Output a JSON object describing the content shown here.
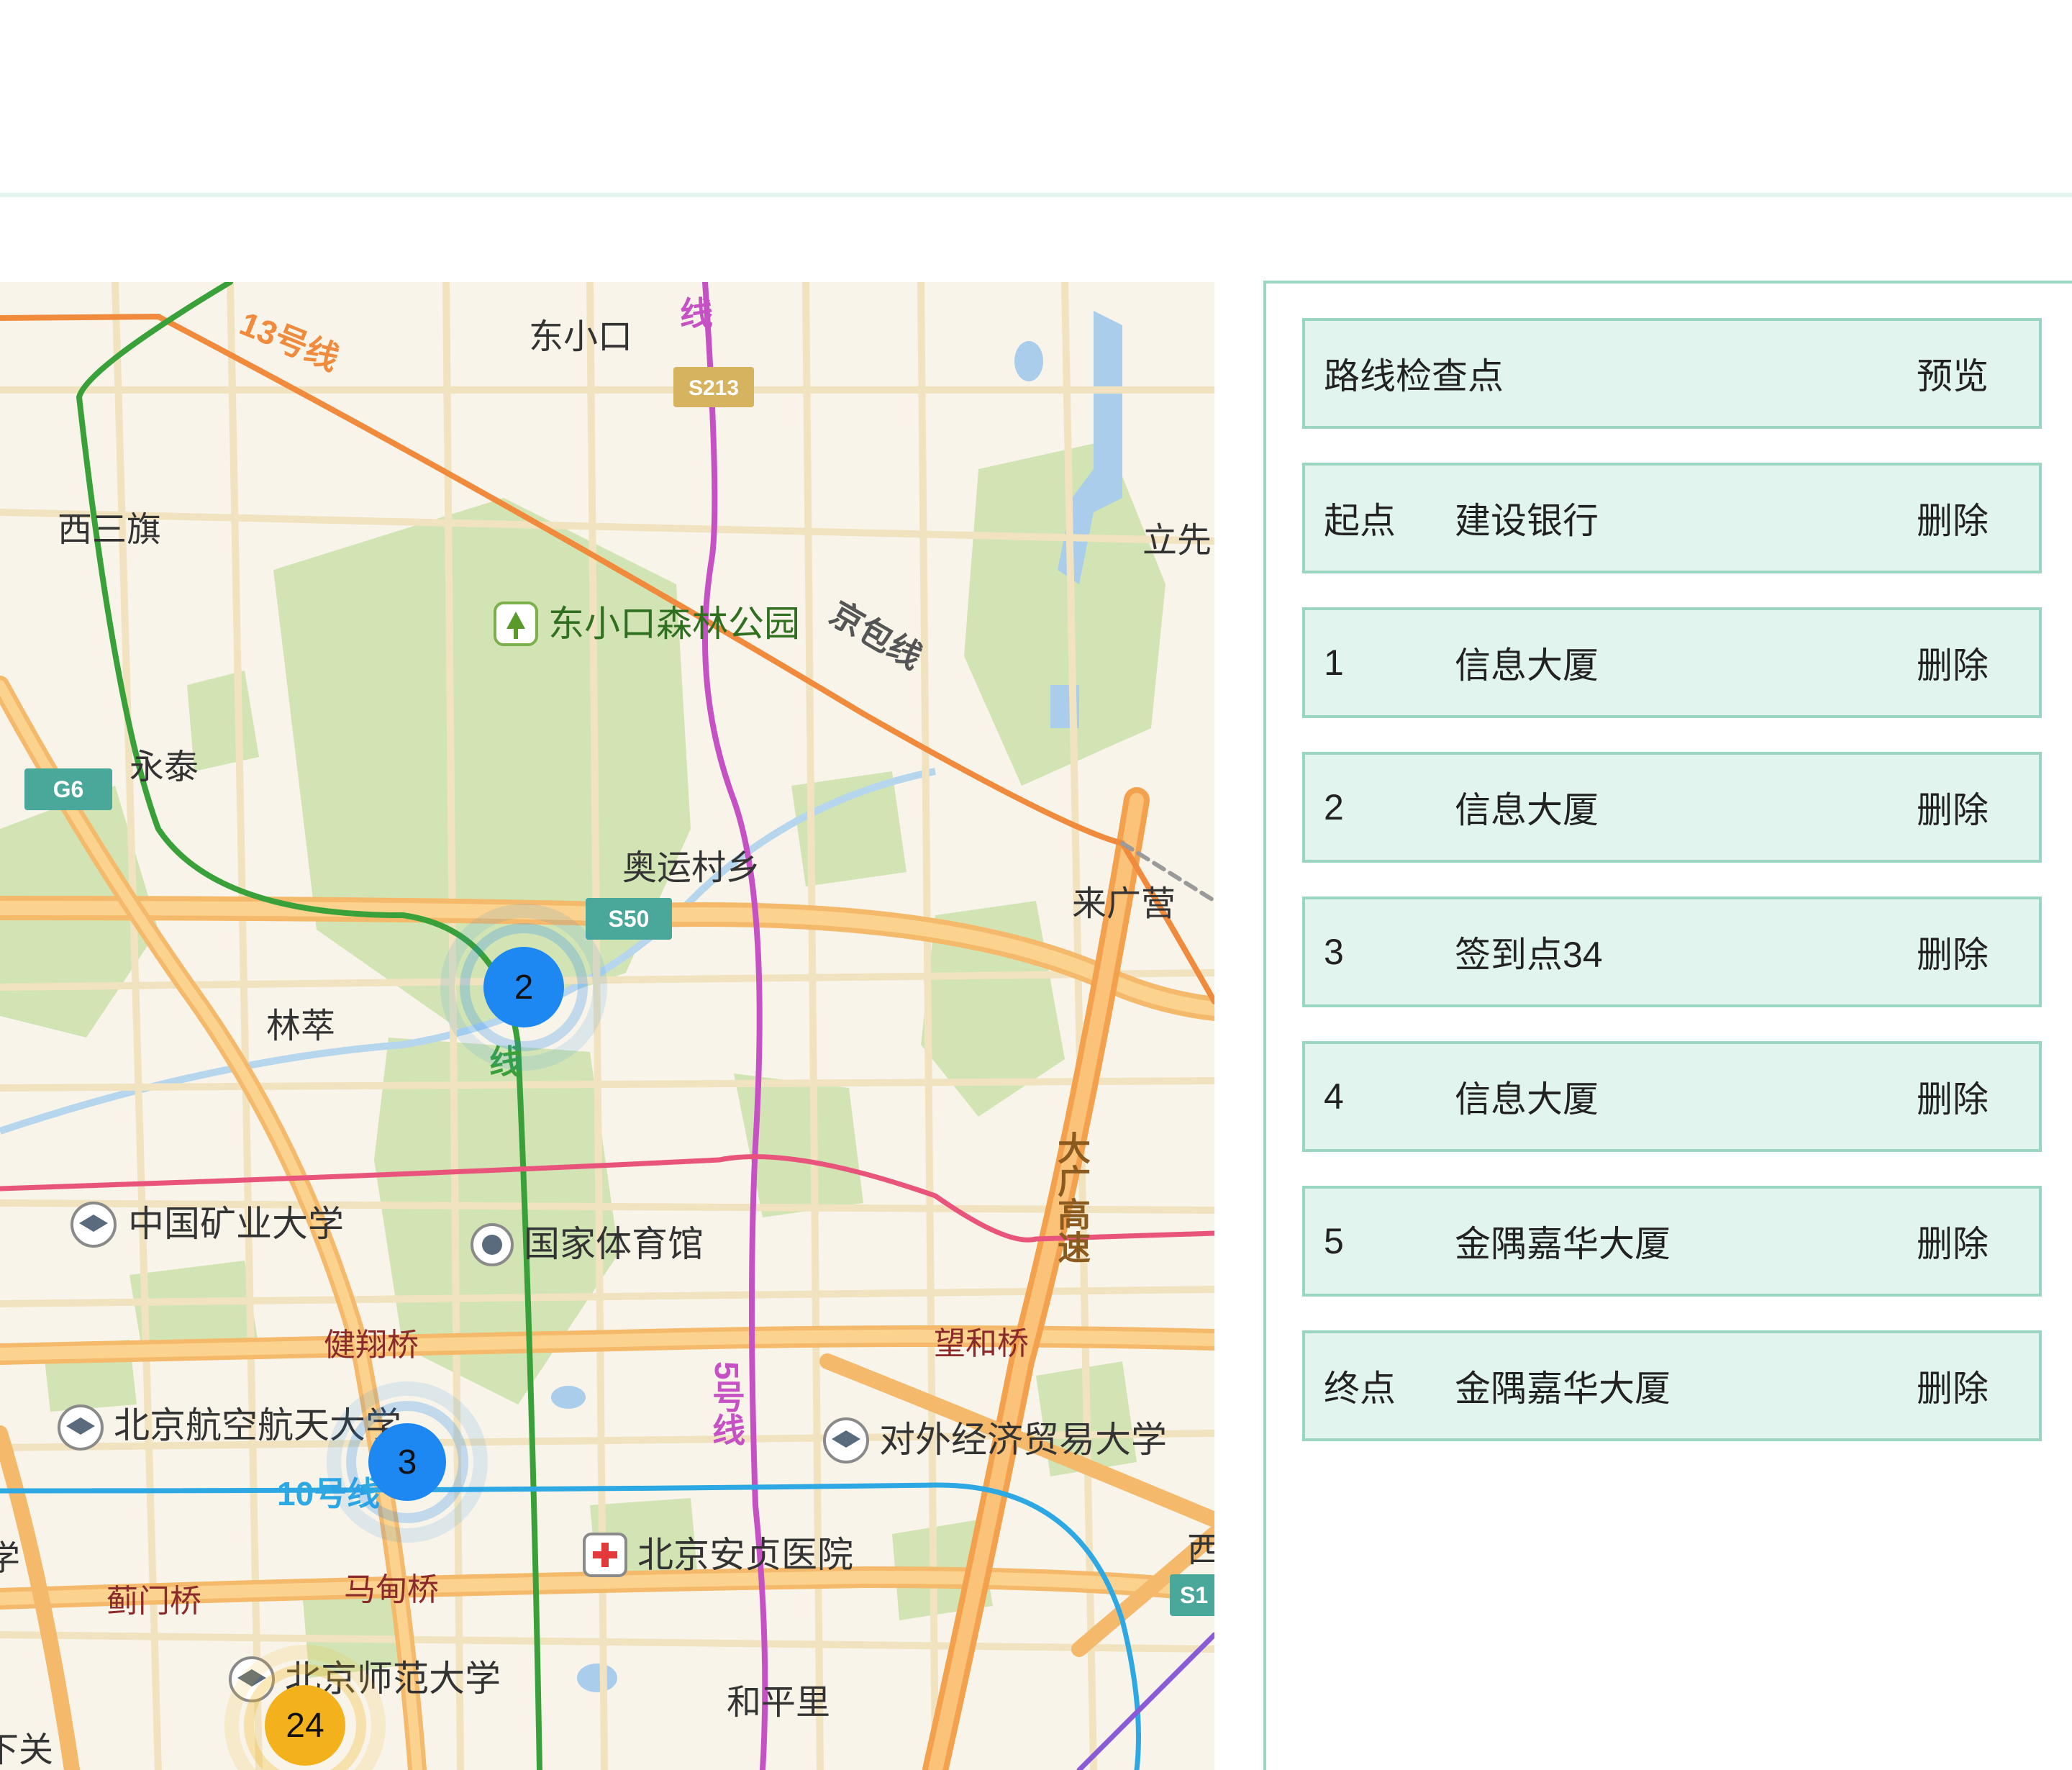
{
  "panel": {
    "header": {
      "title": "路线检查点",
      "action": "预览"
    },
    "rows": [
      {
        "label": "起点",
        "place": "建设银行",
        "action": "删除"
      },
      {
        "label": "1",
        "place": "信息大厦",
        "action": "删除"
      },
      {
        "label": "2",
        "place": "信息大厦",
        "action": "删除"
      },
      {
        "label": "3",
        "place": "签到点34",
        "action": "删除"
      },
      {
        "label": "4",
        "place": "信息大厦",
        "action": "删除"
      },
      {
        "label": "5",
        "place": "金隅嘉华大厦",
        "action": "删除"
      },
      {
        "label": "终点",
        "place": "金隅嘉华大厦",
        "action": "删除"
      }
    ]
  },
  "map": {
    "places": {
      "dongxiaokou": "东小口",
      "xisanqi": "西三旗",
      "lixian": "立先",
      "park": "东小口森林公园",
      "yongtai": "永泰",
      "aoyuncun": "奥运村乡",
      "laiguangying": "来广营",
      "lincui": "林萃",
      "cumtb": "中国矿业大学",
      "gymnasium": "国家体育馆",
      "jianxiangqiao": "健翔桥",
      "wangheqiao": "望和桥",
      "buaa": "北京航空航天大学",
      "uibe": "对外经济贸易大学",
      "anzhen": "北京安贞医院",
      "jimenqiao": "蓟门桥",
      "madianqiao": "马甸桥",
      "bnu": "北京师范大学",
      "hepingli": "和平里",
      "xiaguan": "下关",
      "xue": "学",
      "xi": "西"
    },
    "lines": {
      "line13": "13号线",
      "line5_top": "线",
      "jingbao": "京包线",
      "line8": "线",
      "line5_mid": "5号线",
      "line10": "10号线",
      "expressway": "大广高速"
    },
    "shields": {
      "s213": "S213",
      "g6": "G6",
      "s50": "S50",
      "s1": "S1"
    },
    "clusters": [
      {
        "count": "2",
        "color": "#1e88f2"
      },
      {
        "count": "3",
        "color": "#1e88f2"
      },
      {
        "count": "24",
        "color": "#f3b21b"
      }
    ]
  }
}
